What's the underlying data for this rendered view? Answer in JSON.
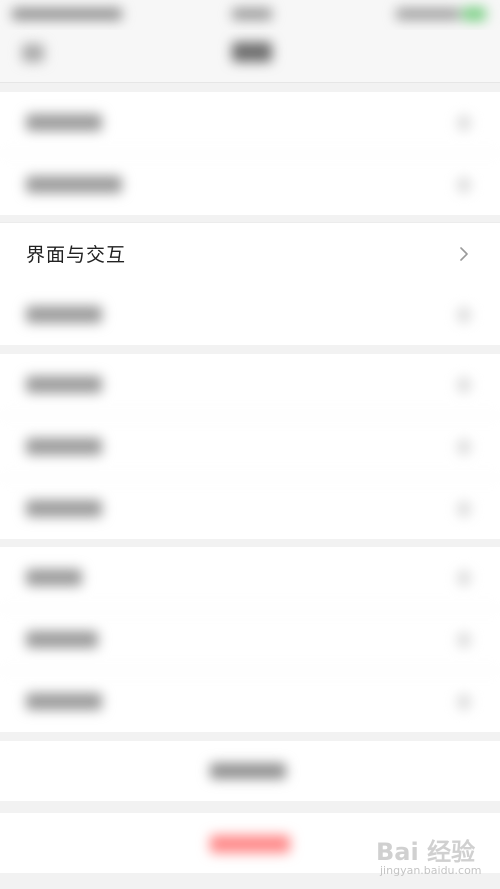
{
  "settings_row": {
    "label": "界面与交互",
    "chevron_icon": "chevron-right-icon"
  },
  "watermark": {
    "brand": "Bai 经验",
    "url": "jingyan.baidu.com"
  },
  "colors": {
    "background": "#f2f2f2",
    "row_background": "#ffffff",
    "text": "#222222",
    "danger": "#ff4d4d",
    "battery": "#4cd964"
  }
}
